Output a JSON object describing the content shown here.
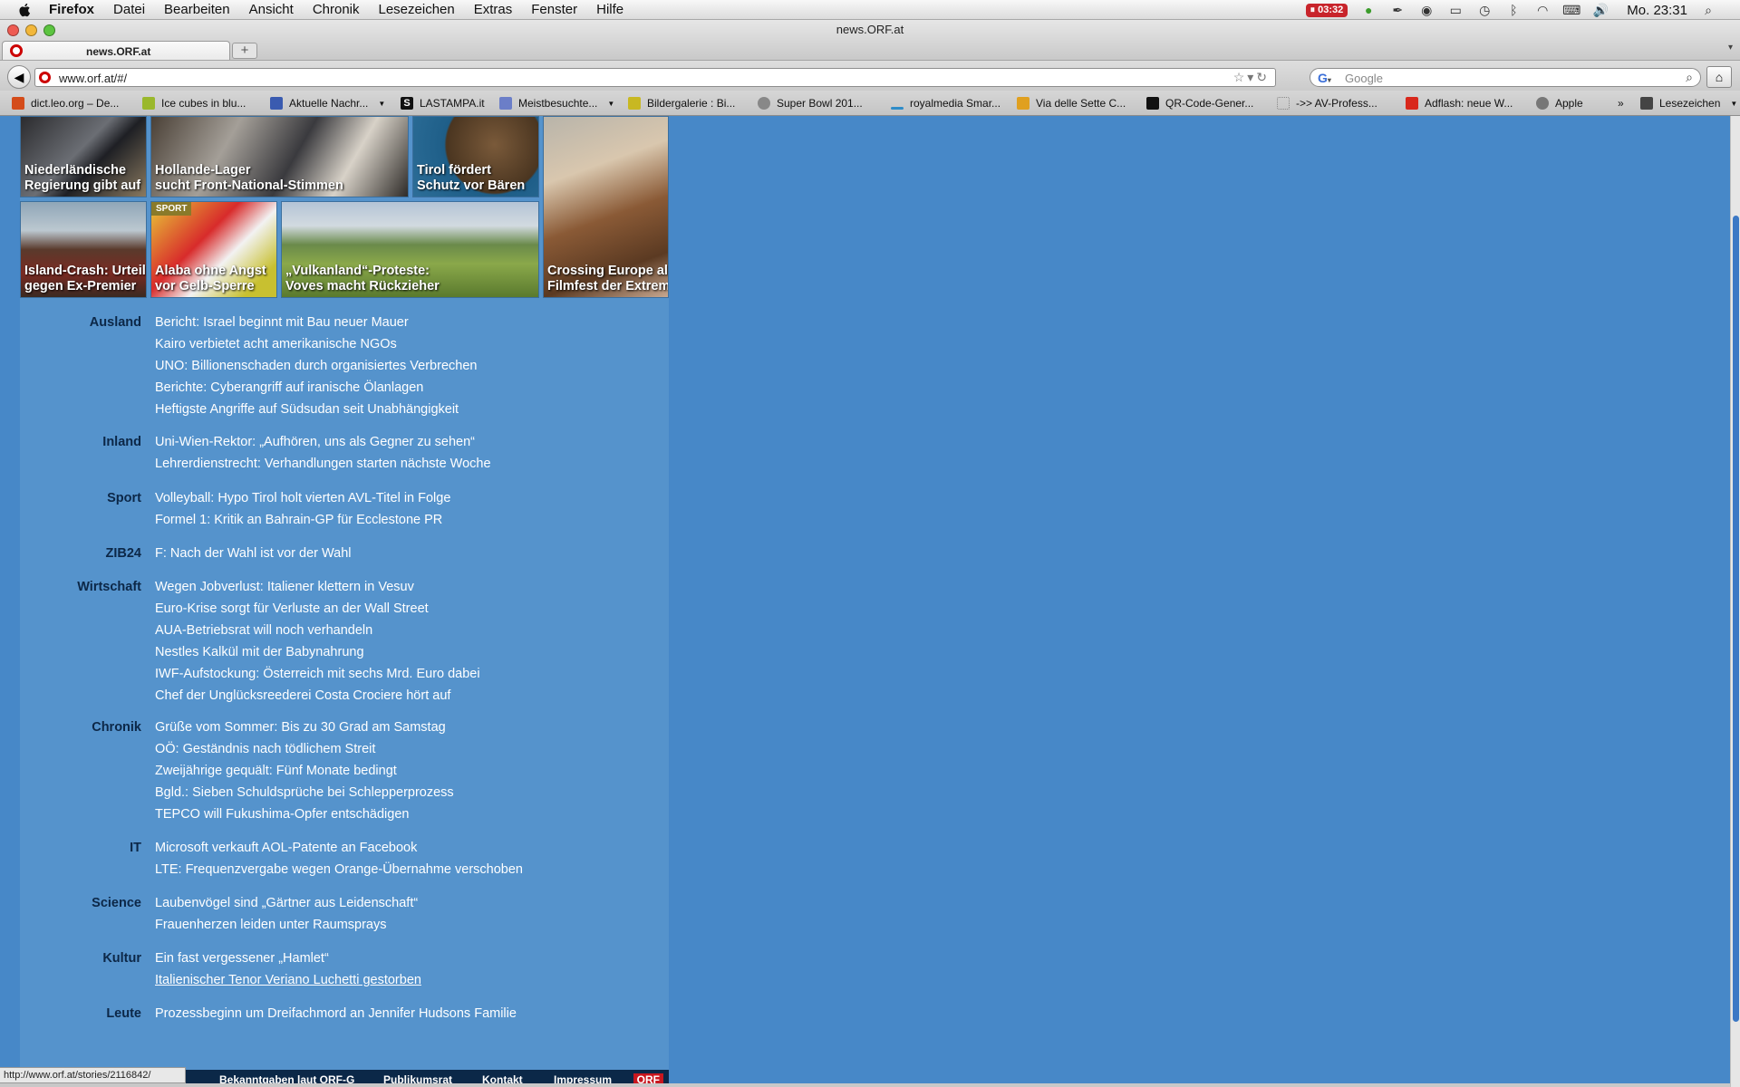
{
  "menubar": {
    "app": "Firefox",
    "items": [
      "Datei",
      "Bearbeiten",
      "Ansicht",
      "Chronik",
      "Lesezeichen",
      "Extras",
      "Fenster",
      "Hilfe"
    ],
    "timer": "03:32",
    "clock": "Mo. 23:31"
  },
  "window": {
    "title": "news.ORF.at"
  },
  "tab": {
    "label": "news.ORF.at",
    "new_tab": "+"
  },
  "nav": {
    "url": "www.orf.at/#/",
    "search_placeholder": "Google"
  },
  "bookmarks": [
    {
      "label": "dict.leo.org – De...",
      "color": "#d44c1a"
    },
    {
      "label": "Ice cubes in blu...",
      "color": "#9ab82c"
    },
    {
      "label": "Aktuelle Nachr...",
      "color": "#3a5bb0",
      "dropdown": true
    },
    {
      "label": "LASTAMPA.it",
      "color": "#111111"
    },
    {
      "label": "Meistbesuchte...",
      "color": "#6b7ec8",
      "dropdown": true
    },
    {
      "label": "Bildergalerie : Bi...",
      "color": "#c8b822"
    },
    {
      "label": "Super Bowl 201...",
      "color": "#888888"
    },
    {
      "label": "royalmedia Smar...",
      "color": "#2e8cc8"
    },
    {
      "label": "Via delle Sette C...",
      "color": "#e0a020"
    },
    {
      "label": "QR-Code-Gener...",
      "color": "#111111"
    },
    {
      "label": "->> AV-Profess...",
      "color": "#bbbbbb"
    },
    {
      "label": "Adflash: neue W...",
      "color": "#d8281c"
    },
    {
      "label": "Apple",
      "color": "#777777"
    },
    {
      "label": "Lesezeichen",
      "color": "#444444",
      "dropdown": true
    }
  ],
  "tiles": [
    {
      "caption": "Niederländische\nRegierung gibt auf"
    },
    {
      "caption": "Hollande-Lager\nsucht Front-National-Stimmen"
    },
    {
      "caption": "Tirol fördert\nSchutz vor Bären"
    },
    {
      "caption": "Island-Crash: Urteil\ngegen Ex-Premier"
    },
    {
      "caption": "Alaba ohne Angst\nvor Gelb-Sperre",
      "tag": "SPORT"
    },
    {
      "caption": "„Vulkanland“-Proteste:\nVoves macht Rückzieher"
    },
    {
      "caption": "Crossing Europe als\nFilmfest der Extreme"
    }
  ],
  "sections": [
    {
      "label": "Ausland",
      "items": [
        "Bericht: Israel beginnt mit Bau neuer Mauer",
        "Kairo verbietet acht amerikanische NGOs",
        "UNO: Billionenschaden durch organisiertes Verbrechen",
        "Berichte: Cyberangriff auf iranische Ölanlagen",
        "Heftigste Angriffe auf Südsudan seit Unabhängigkeit"
      ]
    },
    {
      "label": "Inland",
      "items": [
        "Uni-Wien-Rektor: „Aufhören, uns als Gegner zu sehen“",
        "Lehrerdienstrecht: Verhandlungen starten nächste Woche"
      ]
    },
    {
      "label": "Sport",
      "items": [
        "Volleyball: Hypo Tirol holt vierten AVL-Titel in Folge",
        "Formel 1: Kritik an Bahrain-GP für Ecclestone PR"
      ]
    },
    {
      "label": "ZIB24",
      "items": [
        "F: Nach der Wahl ist vor der Wahl"
      ]
    },
    {
      "label": "Wirtschaft",
      "items": [
        "Wegen Jobverlust: Italiener klettern in Vesuv",
        "Euro-Krise sorgt für Verluste an der Wall Street",
        "AUA-Betriebsrat will noch verhandeln",
        "Nestles Kalkül mit der Babynahrung",
        "IWF-Aufstockung: Österreich mit sechs Mrd. Euro dabei",
        "Chef der Unglücksreederei Costa Crociere hört auf"
      ]
    },
    {
      "label": "Chronik",
      "items": [
        "Grüße vom Sommer: Bis zu 30 Grad am Samstag",
        "OÖ: Geständnis nach tödlichem Streit",
        "Zweijährige gequält: Fünf Monate bedingt",
        "Bgld.: Sieben Schuldsprüche bei Schlepperprozess",
        "TEPCO will Fukushima-Opfer entschädigen"
      ]
    },
    {
      "label": "IT",
      "items": [
        "Microsoft verkauft AOL-Patente an Facebook",
        "LTE: Frequenzvergabe wegen Orange-Übernahme verschoben"
      ]
    },
    {
      "label": "Science",
      "items": [
        "Laubenvögel sind „Gärtner aus Leidenschaft“",
        "Frauenherzen leiden unter Raumsprays"
      ]
    },
    {
      "label": "Kultur",
      "items": [
        "Ein fast vergessener „Hamlet“",
        "Italienischer Tenor Veriano Luchetti gestorben"
      ]
    },
    {
      "label": "Leute",
      "items": [
        "Prozessbeginn um Dreifachmord an Jennifer Hudsons Familie"
      ]
    }
  ],
  "footer": {
    "links": [
      "Bekanntgaben laut ORF-G",
      "Publikumsrat",
      "Kontakt",
      "Impressum"
    ],
    "logo": "ORF"
  },
  "status_url": "http://www.orf.at/stories/2116842/",
  "colors": {
    "page_bg": "#4788c8",
    "column_bg": "#5593cc",
    "section_label": "#0c2747",
    "footer_bg": "#0b2848",
    "orf_red": "#c8171f"
  }
}
